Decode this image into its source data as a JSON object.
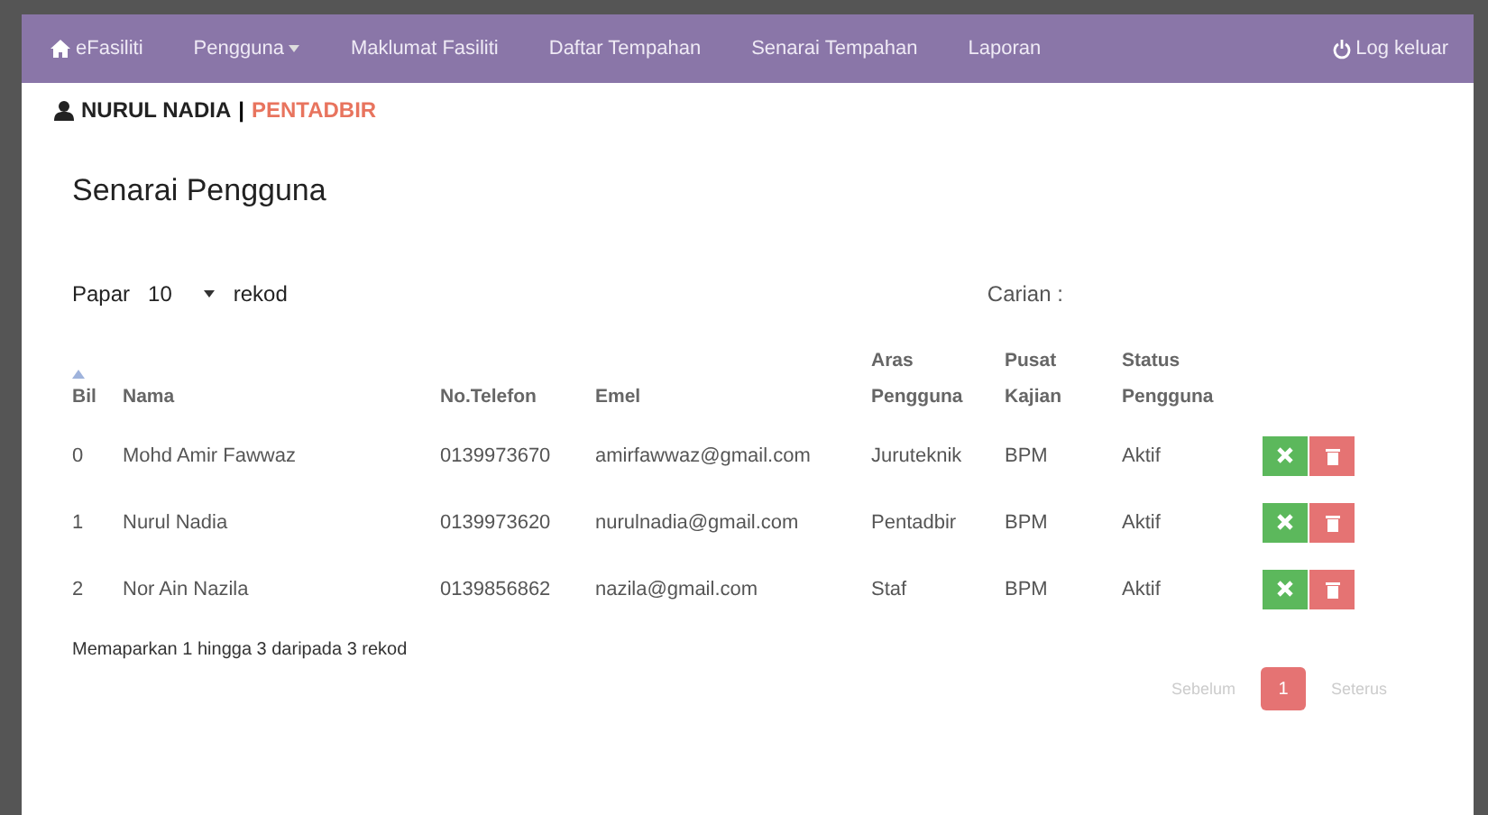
{
  "navbar": {
    "brand": "eFasiliti",
    "items": [
      {
        "label": "Pengguna",
        "dropdown": true
      },
      {
        "label": "Maklumat Fasiliti",
        "dropdown": false
      },
      {
        "label": "Daftar Tempahan",
        "dropdown": false
      },
      {
        "label": "Senarai Tempahan",
        "dropdown": false
      },
      {
        "label": "Laporan",
        "dropdown": false
      }
    ],
    "logout": "Log keluar"
  },
  "user": {
    "name": "NURUL NADIA",
    "separator": "|",
    "role": "PENTADBIR"
  },
  "title": "Senarai Pengguna",
  "length": {
    "label_before": "Papar",
    "value": "10",
    "label_after": "rekod"
  },
  "search": {
    "label": "Carian :"
  },
  "table": {
    "columns": [
      {
        "label": "Bil",
        "sorted": true
      },
      {
        "label": "Nama",
        "sorted": false
      },
      {
        "label": "No.Telefon",
        "sorted": false
      },
      {
        "label": "Emel",
        "sorted": false
      },
      {
        "label": "Aras Pengguna",
        "sorted": false
      },
      {
        "label": "Pusat Kajian",
        "sorted": false
      },
      {
        "label": "Status Pengguna",
        "sorted": false
      }
    ],
    "rows": [
      {
        "cells": [
          "0",
          "Mohd Amir Fawwaz",
          "0139973670",
          "amirfawwaz@gmail.com",
          "Juruteknik",
          "BPM",
          "Aktif"
        ]
      },
      {
        "cells": [
          "1",
          "Nurul Nadia",
          "0139973620",
          "nurulnadia@gmail.com",
          "Pentadbir",
          "BPM",
          "Aktif"
        ]
      },
      {
        "cells": [
          "2",
          "Nor Ain Nazila",
          "0139856862",
          "nazila@gmail.com",
          "Staf",
          "BPM",
          "Aktif"
        ]
      }
    ]
  },
  "info": "Memaparkan 1 hingga 3 daripada 3 rekod",
  "pagination": {
    "previous": "Sebelum",
    "pages": [
      {
        "label": "1",
        "selected": true
      }
    ],
    "next": "Seterus"
  }
}
